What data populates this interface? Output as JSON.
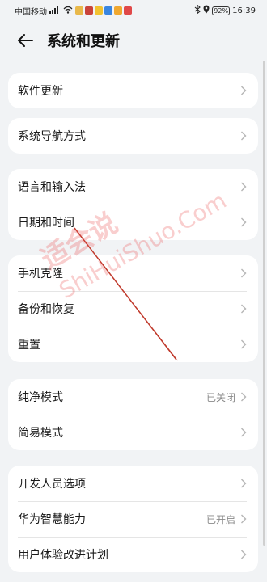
{
  "status_bar": {
    "carrier": "中国移动",
    "signal_label": "46",
    "battery": "92%",
    "time": "16:39",
    "app_icon_colors": [
      "#e8b84a",
      "#c9433a",
      "#f2c230",
      "#3a86e0",
      "#f0a830",
      "#e04848"
    ]
  },
  "header": {
    "title": "系统和更新"
  },
  "cards": [
    {
      "items": [
        {
          "label": "软件更新",
          "value": ""
        }
      ]
    },
    {
      "items": [
        {
          "label": "系统导航方式",
          "value": ""
        }
      ]
    },
    {
      "items": [
        {
          "label": "语言和输入法",
          "value": ""
        },
        {
          "label": "日期和时间",
          "value": ""
        }
      ]
    },
    {
      "items": [
        {
          "label": "手机克隆",
          "value": ""
        },
        {
          "label": "备份和恢复",
          "value": ""
        },
        {
          "label": "重置",
          "value": ""
        }
      ]
    },
    {
      "items": [
        {
          "label": "纯净模式",
          "value": "已关闭"
        },
        {
          "label": "简易模式",
          "value": ""
        }
      ]
    },
    {
      "items": [
        {
          "label": "开发人员选项",
          "value": ""
        },
        {
          "label": "华为智慧能力",
          "value": "已开启"
        },
        {
          "label": "用户体验改进计划",
          "value": ""
        }
      ]
    }
  ],
  "watermark": {
    "cn": "适会说",
    "en": "ShiHuiShuo.Com"
  },
  "colors": {
    "background": "#f1f3f5",
    "card": "#ffffff",
    "secondary_text": "#8a8a8a",
    "annotation_arrow": "#c0392b"
  }
}
